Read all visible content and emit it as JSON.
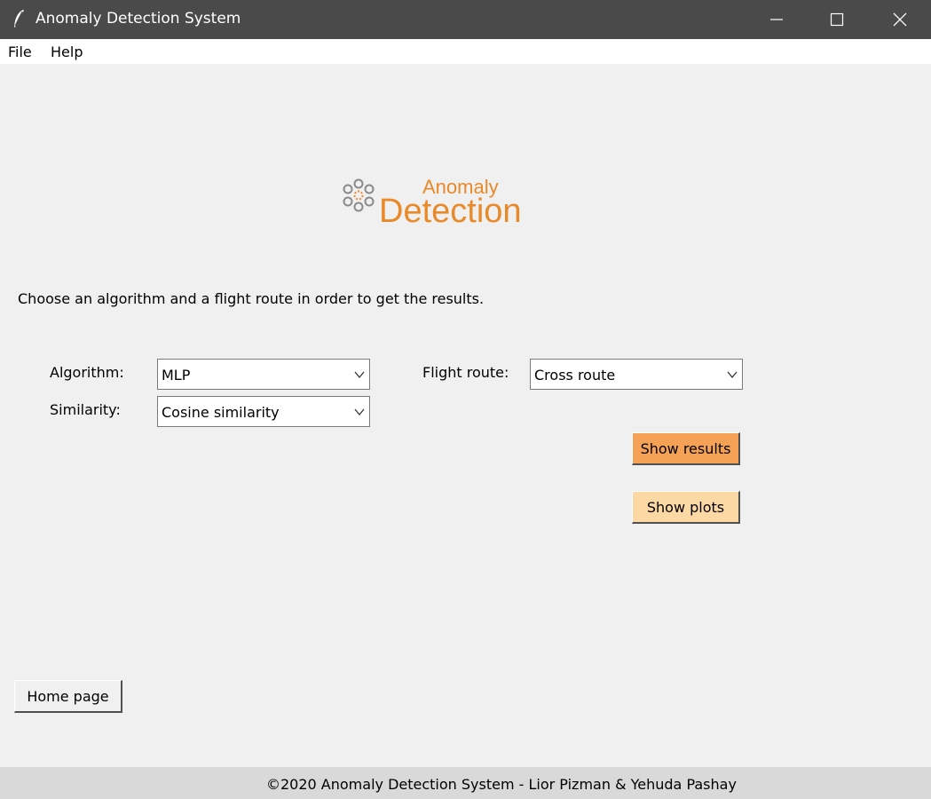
{
  "window": {
    "title": "Anomaly Detection System",
    "icon": "feather-icon"
  },
  "menu": {
    "items": [
      {
        "label": "File"
      },
      {
        "label": "Help"
      }
    ]
  },
  "logo": {
    "line1": "Anomaly",
    "line2": "Detection",
    "color": "#e8892a"
  },
  "main": {
    "instruction": "Choose an algorithm and a flight route in order to get the results.",
    "algorithm": {
      "label": "Algorithm:",
      "value": "MLP"
    },
    "similarity": {
      "label": "Similarity:",
      "value": "Cosine similarity"
    },
    "flight_route": {
      "label": "Flight route:",
      "value": "Cross route"
    },
    "show_results_label": "Show results",
    "show_plots_label": "Show plots",
    "home_page_label": "Home page"
  },
  "footer": {
    "text": "©2020 Anomaly Detection System - Lior Pizman & Yehuda Pashay"
  },
  "colors": {
    "titlebar": "#4a4a4a",
    "background": "#f0f0f0",
    "show_results_bg": "#f5a256",
    "show_plots_bg": "#fcd8a4",
    "footer_bg": "#d9d9d9"
  }
}
